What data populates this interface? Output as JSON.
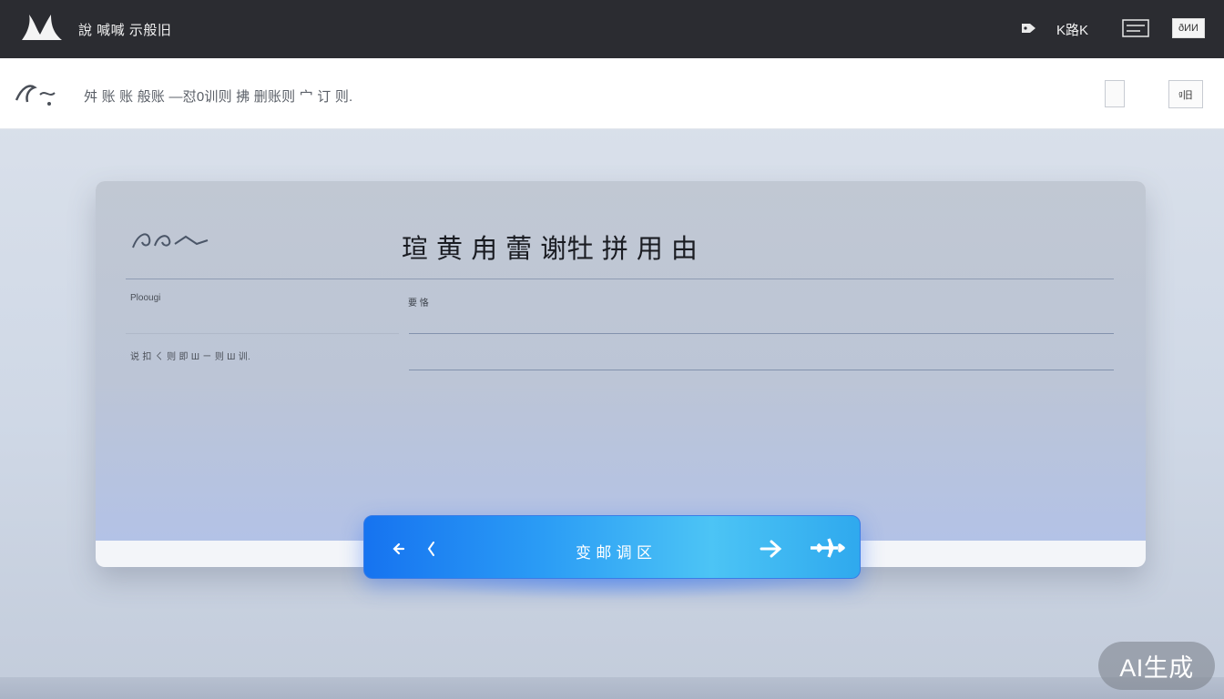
{
  "header": {
    "app_title": "說 喊喊 示般旧",
    "top_link": "K路K",
    "badge_label": "ðИИ"
  },
  "subbar": {
    "description": "舛 账 账 般账 —怼0训则 拂 删账则 宀 订 则.",
    "square_button_label": "ᵍ旧"
  },
  "card": {
    "title": "瑄 黄 甪 蕾 谢牡 拼 用 由",
    "field_left_label": "Ploougi",
    "field_right_label": "要 恪",
    "field_caption": "说 扣 ㄑ 则 即 Ш ㄧ 则 Ш 训."
  },
  "action_bar": {
    "label": "变 邮 调 区"
  },
  "watermark": {
    "text": "AI生成"
  },
  "colors": {
    "topbar": "#2b2c31",
    "action_start": "#1673f0",
    "action_end": "#4cc4f5",
    "card_gray": "#c1c8d3"
  },
  "icons": [
    "logo-icon",
    "tag-icon",
    "menu-icon",
    "document-icon",
    "signature-icon",
    "back-arrow-icon",
    "chevron-left-icon",
    "forward-arrow-icon",
    "airplane-icon"
  ]
}
